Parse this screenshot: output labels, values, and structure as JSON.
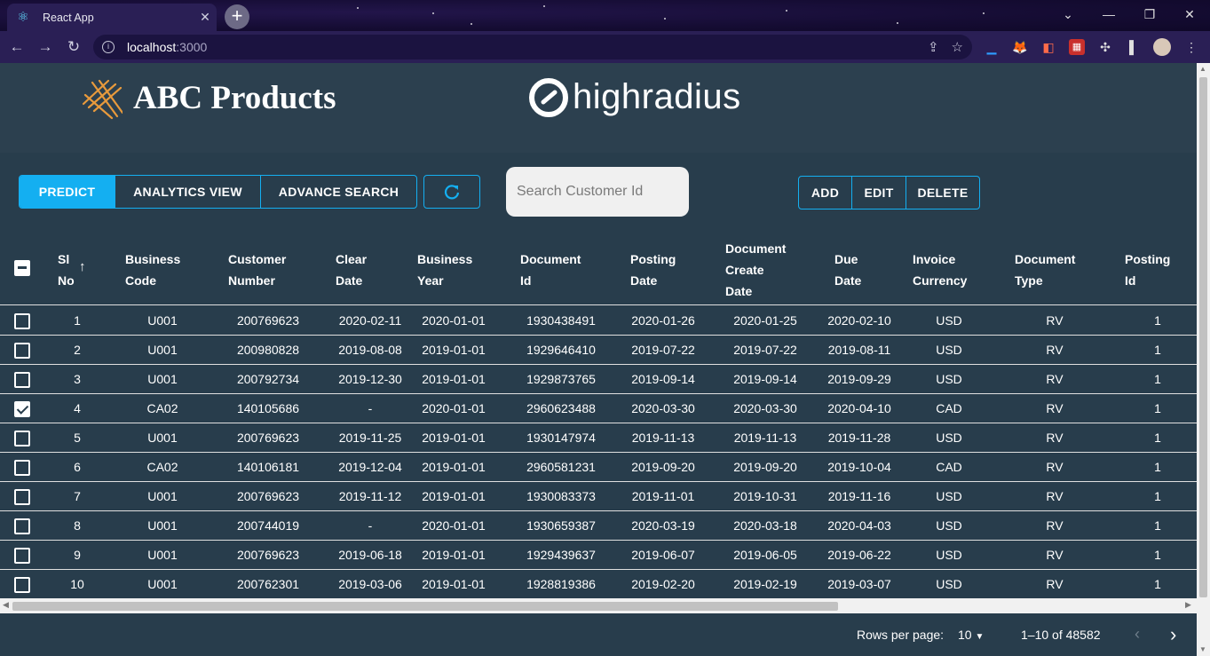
{
  "browser": {
    "tab_title": "React App",
    "url_host": "localhost",
    "url_port": ":3000"
  },
  "header": {
    "brand": "ABC Products",
    "partner": "highradius"
  },
  "toolbar": {
    "predict": "PREDICT",
    "analytics": "ANALYTICS VIEW",
    "advance_search": "ADVANCE SEARCH",
    "search_placeholder": "Search Customer Id",
    "add": "ADD",
    "edit": "EDIT",
    "delete": "DELETE"
  },
  "table": {
    "headers": [
      [
        "Sl",
        "No"
      ],
      [
        "Business",
        "Code"
      ],
      [
        "Customer",
        "Number"
      ],
      [
        "Clear",
        "Date"
      ],
      [
        "Business",
        "Year"
      ],
      [
        "Document",
        "Id"
      ],
      [
        "Posting",
        "Date"
      ],
      [
        "Document",
        "Create",
        "Date"
      ],
      [
        "Due",
        "Date"
      ],
      [
        "Invoice",
        "Currency"
      ],
      [
        "Document",
        "Type"
      ],
      [
        "Posting",
        "Id"
      ]
    ],
    "rows": [
      {
        "checked": false,
        "cells": [
          "1",
          "U001",
          "200769623",
          "2020-02-11",
          "2020-01-01",
          "1930438491",
          "2020-01-26",
          "2020-01-25",
          "2020-02-10",
          "USD",
          "RV",
          "1"
        ]
      },
      {
        "checked": false,
        "cells": [
          "2",
          "U001",
          "200980828",
          "2019-08-08",
          "2019-01-01",
          "1929646410",
          "2019-07-22",
          "2019-07-22",
          "2019-08-11",
          "USD",
          "RV",
          "1"
        ]
      },
      {
        "checked": false,
        "cells": [
          "3",
          "U001",
          "200792734",
          "2019-12-30",
          "2019-01-01",
          "1929873765",
          "2019-09-14",
          "2019-09-14",
          "2019-09-29",
          "USD",
          "RV",
          "1"
        ]
      },
      {
        "checked": true,
        "cells": [
          "4",
          "CA02",
          "140105686",
          "-",
          "2020-01-01",
          "2960623488",
          "2020-03-30",
          "2020-03-30",
          "2020-04-10",
          "CAD",
          "RV",
          "1"
        ]
      },
      {
        "checked": false,
        "cells": [
          "5",
          "U001",
          "200769623",
          "2019-11-25",
          "2019-01-01",
          "1930147974",
          "2019-11-13",
          "2019-11-13",
          "2019-11-28",
          "USD",
          "RV",
          "1"
        ]
      },
      {
        "checked": false,
        "cells": [
          "6",
          "CA02",
          "140106181",
          "2019-12-04",
          "2019-01-01",
          "2960581231",
          "2019-09-20",
          "2019-09-20",
          "2019-10-04",
          "CAD",
          "RV",
          "1"
        ]
      },
      {
        "checked": false,
        "cells": [
          "7",
          "U001",
          "200769623",
          "2019-11-12",
          "2019-01-01",
          "1930083373",
          "2019-11-01",
          "2019-10-31",
          "2019-11-16",
          "USD",
          "RV",
          "1"
        ]
      },
      {
        "checked": false,
        "cells": [
          "8",
          "U001",
          "200744019",
          "-",
          "2020-01-01",
          "1930659387",
          "2020-03-19",
          "2020-03-18",
          "2020-04-03",
          "USD",
          "RV",
          "1"
        ]
      },
      {
        "checked": false,
        "cells": [
          "9",
          "U001",
          "200769623",
          "2019-06-18",
          "2019-01-01",
          "1929439637",
          "2019-06-07",
          "2019-06-05",
          "2019-06-22",
          "USD",
          "RV",
          "1"
        ]
      },
      {
        "checked": false,
        "cells": [
          "10",
          "U001",
          "200762301",
          "2019-03-06",
          "2019-01-01",
          "1928819386",
          "2019-02-20",
          "2019-02-19",
          "2019-03-07",
          "USD",
          "RV",
          "1"
        ]
      }
    ]
  },
  "pagination": {
    "rows_per_page_label": "Rows per page:",
    "rows_per_page": "10",
    "range": "1–10 of 48582"
  },
  "colors": {
    "accent": "#14aff1",
    "header_bg": "#2c404f",
    "body_bg": "#283d4c",
    "brand_logo": "#e89a3c"
  }
}
